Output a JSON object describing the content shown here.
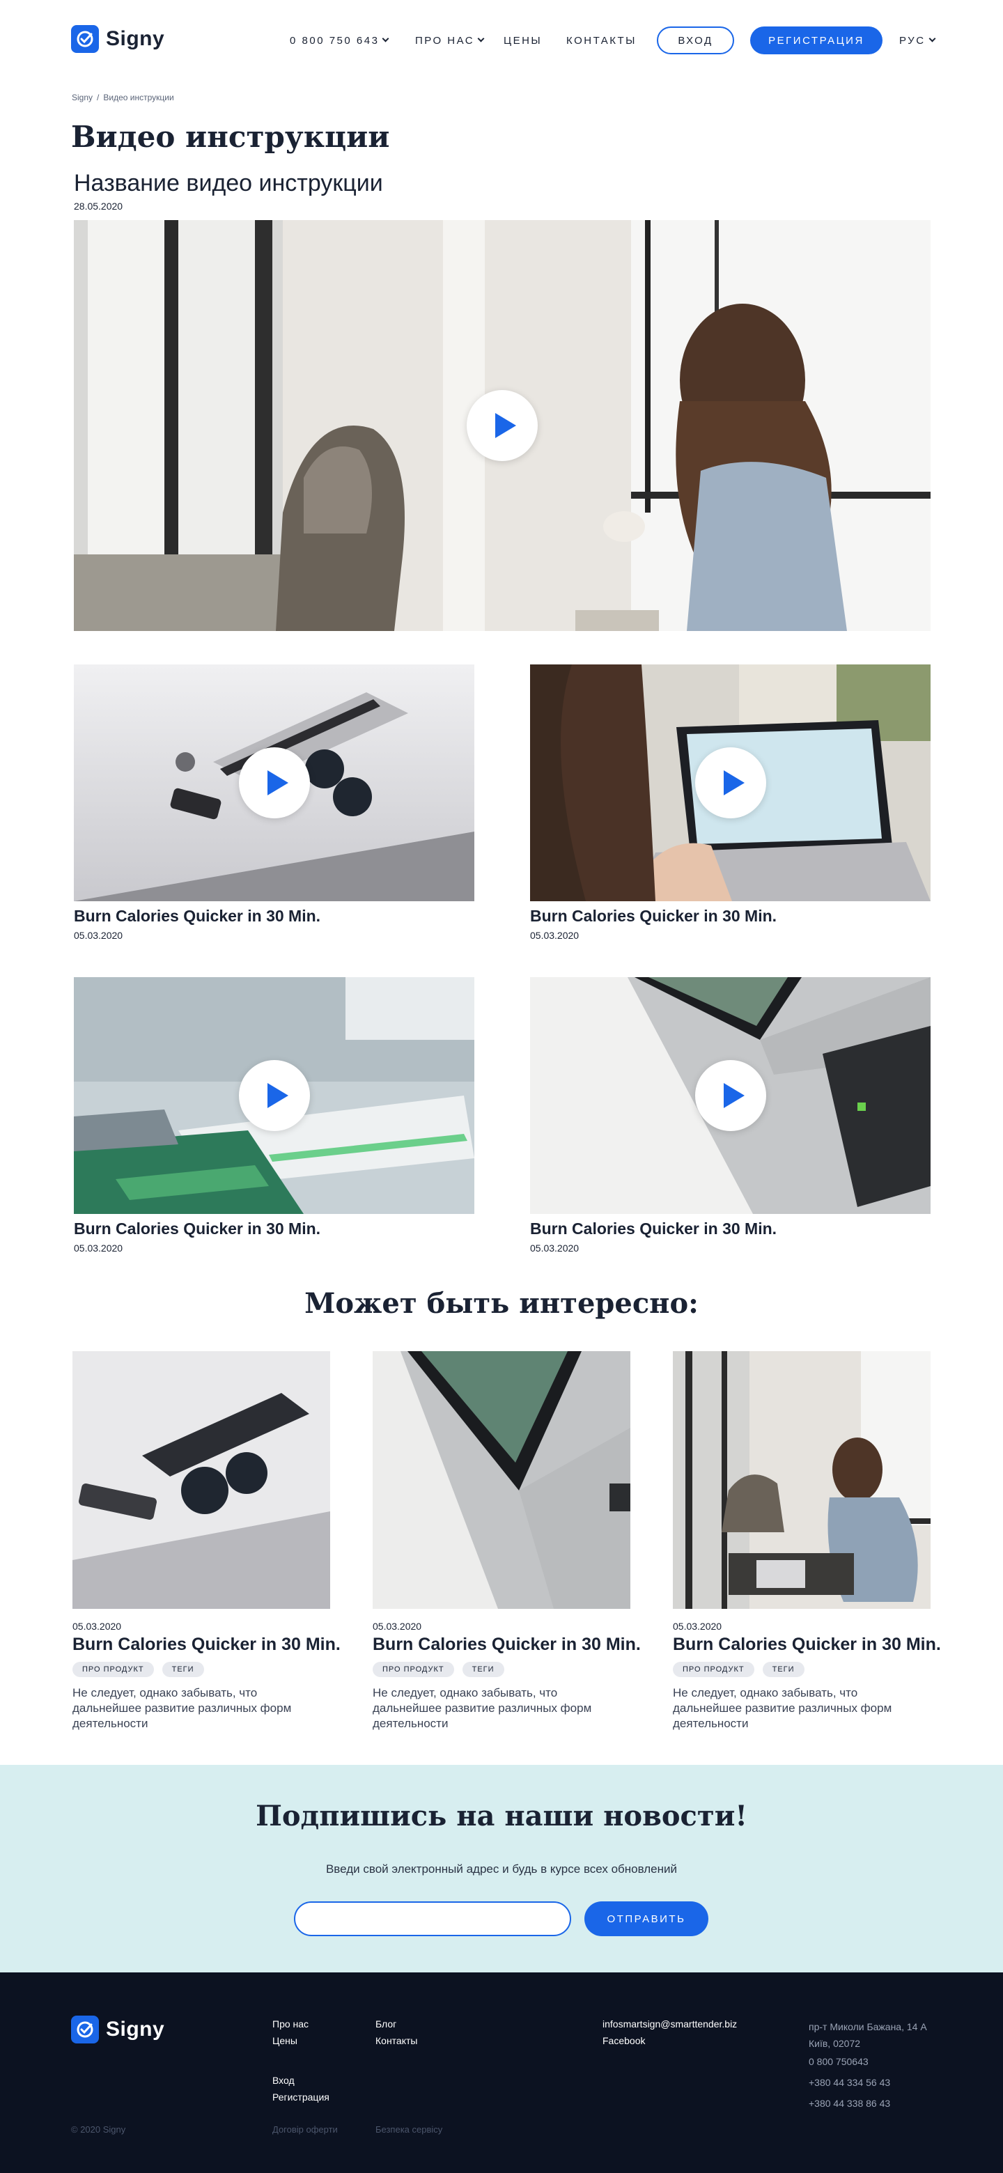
{
  "header": {
    "logo_text": "Signy",
    "phone": "0 800 750 643",
    "nav": {
      "about": "ПРО НАС",
      "prices": "ЦЕНЫ",
      "contacts": "КОНТАКТЫ"
    },
    "login": "ВХОД",
    "register": "РЕГИСТРАЦИЯ",
    "language": "РУС"
  },
  "breadcrumb": {
    "home": "Signy",
    "separator": "/",
    "current": "Видео инструкции"
  },
  "page_title": "Видео инструкции",
  "main_video": {
    "title": "Название видео инструкции",
    "date": "28.05.2020"
  },
  "videos": [
    {
      "title": "Burn Calories Quicker in 30 Min.",
      "date": "05.03.2020"
    },
    {
      "title": "Burn Calories Quicker in 30 Min.",
      "date": "05.03.2020"
    },
    {
      "title": "Burn Calories Quicker in 30 Min.",
      "date": "05.03.2020"
    },
    {
      "title": "Burn Calories Quicker in 30 Min.",
      "date": "05.03.2020"
    }
  ],
  "related": {
    "title": "Может быть интересно:",
    "cards": [
      {
        "date": "05.03.2020",
        "title": "Burn Calories Quicker in 30 Min.",
        "tags": [
          "ПРО ПРОДУКТ",
          "ТЕГИ"
        ],
        "text": "Не следует, однако забывать, что дальнейшее развитие различных форм деятельности"
      },
      {
        "date": "05.03.2020",
        "title": "Burn Calories Quicker in 30 Min.",
        "tags": [
          "ПРО ПРОДУКТ",
          "ТЕГИ"
        ],
        "text": "Не следует, однако забывать, что дальнейшее развитие различных форм деятельности"
      },
      {
        "date": "05.03.2020",
        "title": "Burn Calories Quicker in 30 Min.",
        "tags": [
          "ПРО ПРОДУКТ",
          "ТЕГИ"
        ],
        "text": "Не следует, однако забывать, что дальнейшее развитие различных форм деятельности"
      }
    ]
  },
  "subscribe": {
    "title": "Подпишись на наши новости!",
    "text": "Введи свой электронный адрес и будь в курсе всех обновлений",
    "placeholder": "",
    "button": "ОТПРАВИТЬ"
  },
  "footer": {
    "logo_text": "Signy",
    "links": {
      "about": "Про нас",
      "prices": "Цены",
      "blog": "Блог",
      "contacts": "Контакты",
      "login": "Вход",
      "register": "Регистрация"
    },
    "email": "infosmartsign@smarttender.biz",
    "facebook": "Facebook",
    "address": "пр-т Миколи Бажана, 14 А Київ, 02072",
    "phones": [
      "0 800 750643",
      "+380 44 334 56 43",
      "+380 44 338 86 43"
    ],
    "copyright": "© 2020 Signy",
    "offer": "Договір оферти",
    "security": "Безпека сервісу"
  },
  "colors": {
    "accent": "#1a66e8",
    "subscribe_bg": "#d7eef0",
    "footer_bg": "#0c1221"
  }
}
